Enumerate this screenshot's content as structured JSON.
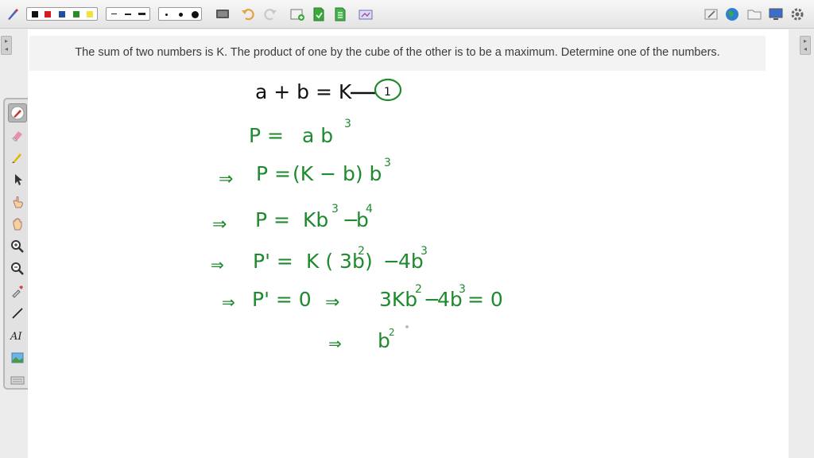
{
  "question": {
    "text": "The sum of two numbers is K. The product of one by the cube of the other is to be a maximum. Determine one of the numbers."
  },
  "work": {
    "line1": {
      "lhs": "a + b = K",
      "tag": "1"
    },
    "line2": {
      "lhs": "P =",
      "base": "a b",
      "exp": "3"
    },
    "line3": {
      "arrow": "⇒",
      "lhs": "P =",
      "body": "(K − b) b",
      "exp": "3"
    },
    "line4": {
      "arrow": "⇒",
      "lhs": "P =",
      "t1": "Kb",
      "e1": "3",
      "op": "−",
      "t2": "b",
      "e2": "4"
    },
    "line5": {
      "arrow": "⇒",
      "lhs": "P' =",
      "t1": "K ( 3b",
      "e1": "2",
      "close": ")",
      "op": "−",
      "t2": "4b",
      "e2": "3"
    },
    "line6": {
      "arrow": "⇒",
      "lhs": "P' = 0",
      "arrow2": "⇒",
      "t1": "3Kb",
      "e1": "2",
      "op": "−",
      "t2": "4b",
      "e2": "3",
      "rhs": "= 0"
    },
    "line7": {
      "arrow": "⇒",
      "t1": "b",
      "e1": "2"
    }
  },
  "colors": {
    "ink_black": "#111111",
    "ink_green": "#1e8a2e",
    "toolbar_red": "#d21e1e",
    "toolbar_blue": "#1e4ea0",
    "toolbar_green": "#2a8a2a",
    "toolbar_yellow": "#f4e23c"
  },
  "icons": {
    "toolbar": [
      "pen-icon",
      "undo-icon",
      "redo-icon",
      "new-page-icon",
      "save-icon",
      "export-icon",
      "screen-icon",
      "globe-icon",
      "folder-icon",
      "monitor-icon",
      "settings-icon"
    ],
    "tools": [
      "pen-tool-icon",
      "eraser-icon",
      "highlighter-icon",
      "select-arrow-icon",
      "pointer-hand-icon",
      "pan-hand-icon",
      "zoom-in-icon",
      "zoom-out-icon",
      "eyedropper-icon",
      "line-icon",
      "text-icon",
      "image-icon",
      "keyboard-icon"
    ]
  }
}
